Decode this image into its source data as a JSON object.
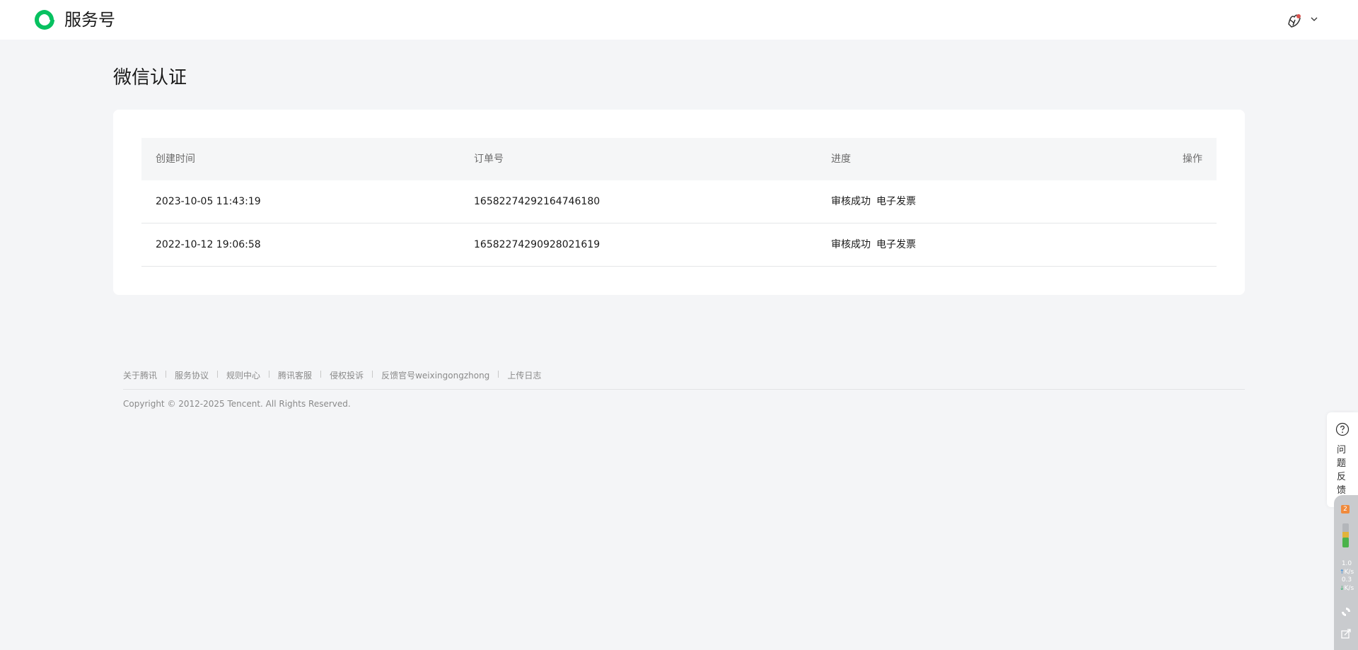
{
  "header": {
    "brand": "服务号",
    "logo_icon": "wechat-service-account-logo-icon",
    "accent_color": "#07c160",
    "avatar_icon": "user-avatar-icon",
    "dropdown_icon": "chevron-down-icon"
  },
  "page": {
    "title": "微信认证"
  },
  "table": {
    "headers": {
      "created_time": "创建时间",
      "order_no": "订单号",
      "progress": "进度",
      "actions": "操作"
    },
    "rows": [
      {
        "created_time": "2023-10-05 11:43:19",
        "order_no": "16582274292164746180",
        "status": "审核成功",
        "invoice": "电子发票"
      },
      {
        "created_time": "2022-10-12 19:06:58",
        "order_no": "16582274290928021619",
        "status": "审核成功",
        "invoice": "电子发票"
      }
    ]
  },
  "footer": {
    "links": [
      "关于腾讯",
      "服务协议",
      "规则中心",
      "腾讯客服",
      "侵权投诉",
      "反馈官号weixingongzhong",
      "上传日志"
    ],
    "copyright": "Copyright © 2012-2025 Tencent. All Rights Reserved."
  },
  "feedback": {
    "icon": "question-circle-icon",
    "label": "问题反馈"
  },
  "system_monitor": {
    "badge": "2",
    "upload_speed": "1.0",
    "upload_unit": "K/s",
    "download_speed": "0.3",
    "download_unit": "K/s"
  }
}
